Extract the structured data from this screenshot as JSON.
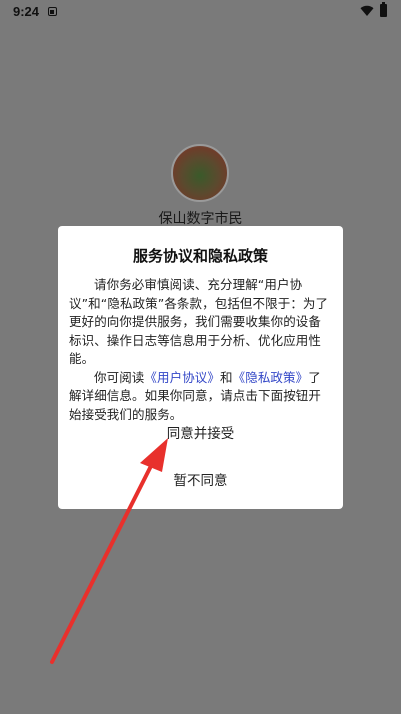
{
  "status_bar": {
    "time": "9:24"
  },
  "app": {
    "name": "保山数字市民"
  },
  "dialog": {
    "title": "服务协议和隐私政策",
    "para1": "请你务必审慎阅读、充分理解“用户协议”和“隐私政策”各条款，包括但不限于：为了更好的向你提供服务，我们需要收集你的设备标识、操作日志等信息用于分析、优化应用性能。",
    "para2_prefix": "你可阅读",
    "link_user_agreement": "《用户协议》",
    "para2_and": "和",
    "link_privacy_policy": "《隐私政策》",
    "para2_suffix": "了解详细信息。如果你同意，请点击下面按钮开始接受我们的服务。",
    "accept_label": "同意并接受",
    "decline_label": "暂不同意"
  },
  "colors": {
    "link": "#3347c7",
    "arrow": "#e8302c",
    "overlay": "#7a7a7a"
  }
}
